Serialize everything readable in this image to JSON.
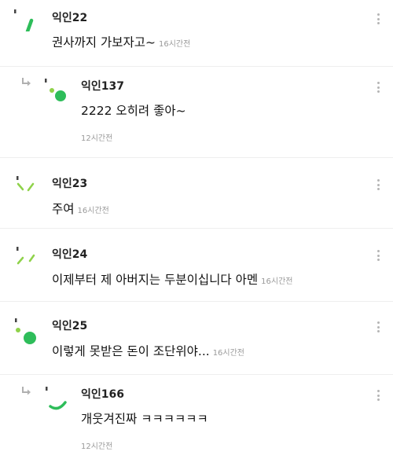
{
  "comments": [
    {
      "name": "익인22",
      "text": "권사까지 가보자고~",
      "time": "16시간전"
    },
    {
      "name": "익인137",
      "text": "2222 오히려 좋아~",
      "time": "12시간전"
    },
    {
      "name": "익인23",
      "text": "주여",
      "time": "16시간전"
    },
    {
      "name": "익인24",
      "text": "이제부터 제 아버지는 두분이십니다 아멘",
      "time": "16시간전"
    },
    {
      "name": "익인25",
      "text": "이렇게 못받은 돈이 조단위야...",
      "time": "16시간전"
    },
    {
      "name": "익인166",
      "text": "개웃겨진짜 ㅋㅋㅋㅋㅋㅋ",
      "time": "12시간전"
    }
  ],
  "colors": {
    "avatar_green": "#2ebd5a",
    "avatar_lime": "#8fd24a",
    "reply_arrow": "#b0b0b0",
    "more_dots": "#b5b5b5"
  },
  "icons": {
    "reply": "reply-arrow-icon",
    "more": "more-vertical-icon"
  }
}
